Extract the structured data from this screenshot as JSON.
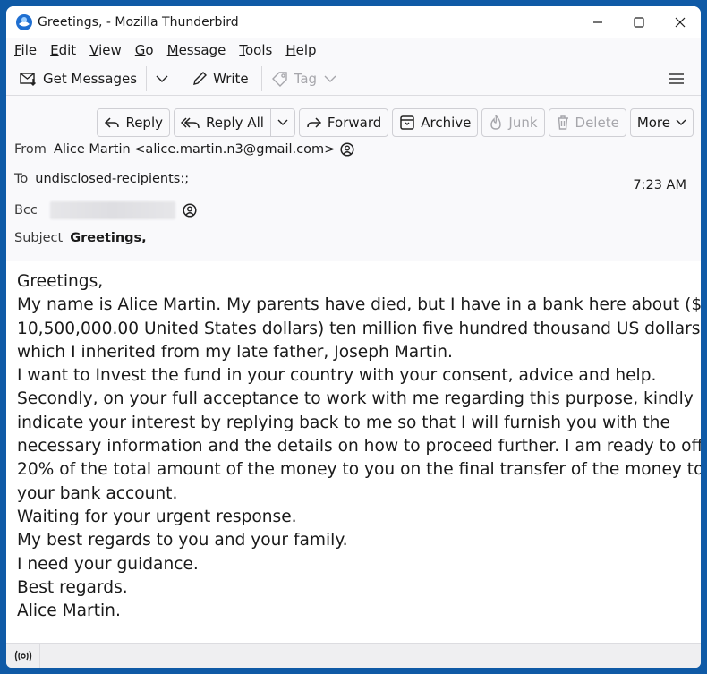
{
  "window": {
    "title": "Greetings, - Mozilla Thunderbird",
    "controls": {
      "minimize": "minimize",
      "maximize": "maximize",
      "close": "close"
    }
  },
  "menubar": {
    "items": [
      {
        "label": "File",
        "accel": "F",
        "rest": "ile"
      },
      {
        "label": "Edit",
        "accel": "E",
        "rest": "dit"
      },
      {
        "label": "View",
        "accel": "V",
        "rest": "iew"
      },
      {
        "label": "Go",
        "accel": "G",
        "rest": "o"
      },
      {
        "label": "Message",
        "accel": "M",
        "rest": "essage"
      },
      {
        "label": "Tools",
        "accel": "T",
        "rest": "ools"
      },
      {
        "label": "Help",
        "accel": "H",
        "rest": "elp"
      }
    ]
  },
  "toolbar": {
    "get_messages": "Get Messages",
    "write": "Write",
    "tag": "Tag"
  },
  "actions": {
    "reply": "Reply",
    "reply_all": "Reply All",
    "forward": "Forward",
    "archive": "Archive",
    "junk": "Junk",
    "delete": "Delete",
    "more": "More"
  },
  "header": {
    "from_label": "From",
    "from_value": "Alice Martin <alice.martin.n3@gmail.com>",
    "to_label": "To",
    "to_value": "undisclosed-recipients:;",
    "bcc_label": "Bcc",
    "subject_label": "Subject",
    "subject_value": "Greetings,",
    "time": "7:23 AM"
  },
  "body": {
    "lines": [
      "Greetings,",
      "My name is Alice Martin. My parents have died, but I have in a bank here about ($",
      "10,500,000.00 United States dollars) ten million five hundred thousand US dollars",
      "which I inherited from my late father, Joseph Martin.",
      "I want to Invest the fund in your country with your consent, advice and help.",
      "Secondly, on your full acceptance to work with me regarding this purpose, kindly",
      "indicate your interest by replying back to me so that I will furnish you with the",
      "necessary information and the details on how to proceed further. I am ready to offer",
      "20% of the total amount of the money to you on the final transfer of the money to",
      "your bank account.",
      "Waiting for your urgent response.",
      "My best regards to you and your family.",
      "I need your guidance.",
      "Best regards.",
      "Alice Martin."
    ]
  },
  "statusbar": {
    "icon": "online-status-icon"
  },
  "colors": {
    "desktop": "#0f5aa6",
    "window_bg": "#f9f9fb",
    "body_bg": "#ffffff",
    "disabled": "#a6a6ab"
  }
}
